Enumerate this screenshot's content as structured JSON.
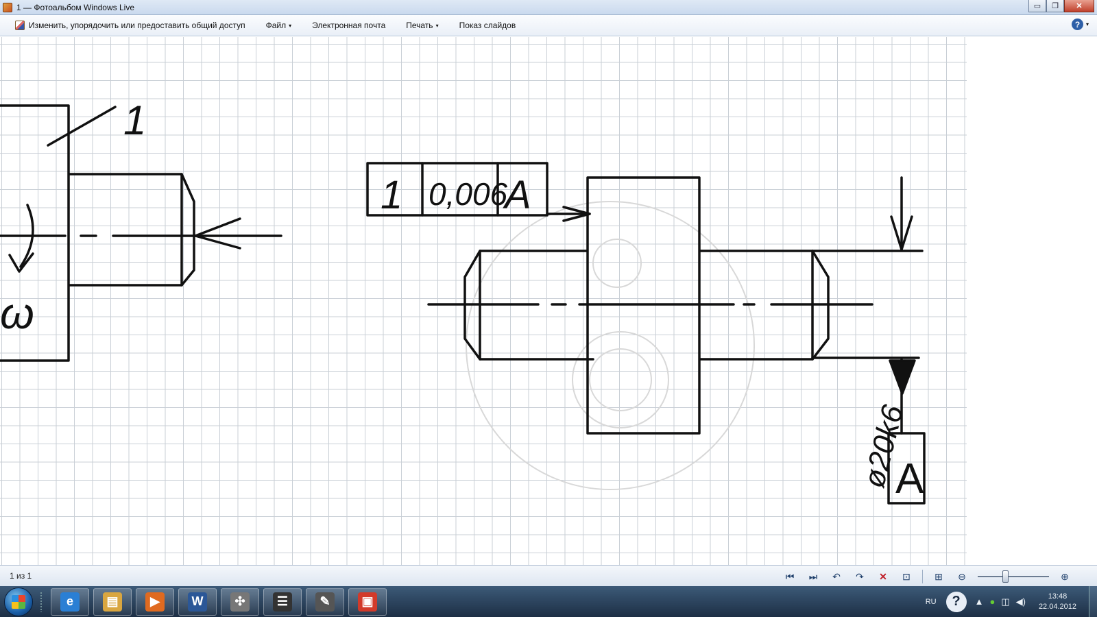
{
  "window": {
    "title": "1 — Фотоальбом Windows Live",
    "minimize": "▭",
    "maximize": "❐",
    "close": "✕"
  },
  "menu": {
    "items": [
      {
        "label": "Изменить, упорядочить или предоставить общий доступ",
        "icon": "edit-photo-icon",
        "dropdown": false
      },
      {
        "label": "Файл",
        "dropdown": true
      },
      {
        "label": "Электронная почта",
        "dropdown": false
      },
      {
        "label": "Печать",
        "dropdown": true
      },
      {
        "label": "Показ слайдов",
        "dropdown": false
      }
    ],
    "help_symbol": "?",
    "caret": "▾"
  },
  "photo": {
    "left_drawing": {
      "leader_number": "1",
      "rotation_symbol": "ω"
    },
    "right_drawing": {
      "tolerance_frame": [
        "1",
        "0,006",
        "A"
      ],
      "dimension": "ø20k6",
      "datum": "A"
    }
  },
  "controls": {
    "counter": "1 из 1",
    "buttons": {
      "previous": "⏮",
      "next": "⏭",
      "rotate_left": "↶",
      "rotate_right": "↷",
      "delete": "✕",
      "slideshow": "⊡",
      "actual_size": "⊞",
      "zoom_out": "⊖",
      "zoom_in": "⊕"
    },
    "zoom_level": 0.38
  },
  "taskbar": {
    "apps": [
      {
        "name": "internet-explorer",
        "glyph": "e",
        "color": "#2a7fd4"
      },
      {
        "name": "file-explorer",
        "glyph": "▤",
        "color": "#d9a640"
      },
      {
        "name": "media-player",
        "glyph": "▶",
        "color": "#e06a20"
      },
      {
        "name": "word",
        "glyph": "W",
        "color": "#2b5797"
      },
      {
        "name": "drawing-app",
        "glyph": "✣",
        "color": "#777777"
      },
      {
        "name": "storage-app",
        "glyph": "☰",
        "color": "#333333"
      },
      {
        "name": "scanner-app",
        "glyph": "✎",
        "color": "#555555"
      },
      {
        "name": "photo-gallery",
        "glyph": "▣",
        "color": "#d23a2a"
      }
    ],
    "language": "RU",
    "help_symbol": "?",
    "tray_icons": {
      "show_hidden": "▲",
      "antivirus": "●",
      "network": "◫",
      "volume": "◀)"
    },
    "time": "13:48",
    "date": "22.04.2012"
  }
}
